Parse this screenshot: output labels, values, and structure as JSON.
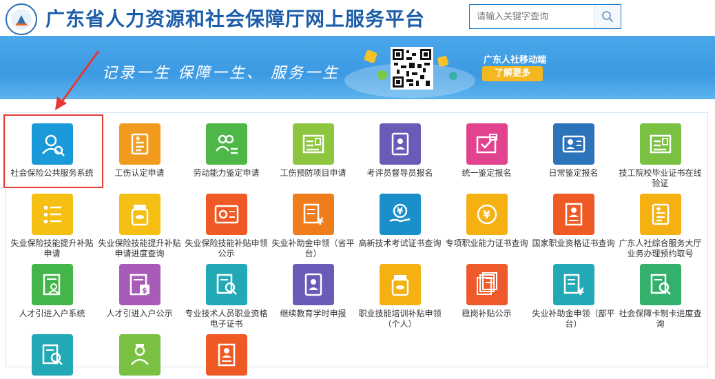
{
  "header": {
    "title": "广东省人力资源和社会保障厅网上服务平台",
    "search_placeholder": "请输入关键字查询"
  },
  "banner": {
    "slogan": "记录一生  保障一生、 服务一生",
    "mobile_label": "广东人社移动端",
    "more_button": "了解更多"
  },
  "services": [
    {
      "label": "社会保险公共服务系统",
      "icon": "user-search-icon",
      "color": "#1a9ad8"
    },
    {
      "label": "工伤认定申请",
      "icon": "document-plus-icon",
      "color": "#f29a1d"
    },
    {
      "label": "劳动能力鉴定申请",
      "icon": "people-transfer-icon",
      "color": "#4db848"
    },
    {
      "label": "工伤预防项目申请",
      "icon": "certificate-icon",
      "color": "#8cc63e"
    },
    {
      "label": "考评员督导员报名",
      "icon": "id-card-icon",
      "color": "#6b5ab8"
    },
    {
      "label": "统一鉴定报名",
      "icon": "approval-folder-icon",
      "color": "#e2438f"
    },
    {
      "label": "日常鉴定报名",
      "icon": "profile-edit-icon",
      "color": "#2d73b9"
    },
    {
      "label": "技工院校毕业证书在线验证",
      "icon": "certificate-icon",
      "color": "#7ac143"
    },
    {
      "label": "失业保险技能提升补贴申请",
      "icon": "checklist-icon",
      "color": "#f5c013"
    },
    {
      "label": "失业保险技能提升补贴申请进度查询",
      "icon": "pill-jar-icon",
      "color": "#f5c013"
    },
    {
      "label": "失业保险技能补贴申领公示",
      "icon": "money-card-icon",
      "color": "#ef5a24"
    },
    {
      "label": "失业补助金申领（省平台）",
      "icon": "document-yuan-icon",
      "color": "#ef7d1b"
    },
    {
      "label": "高新技术考试证书查询",
      "icon": "hand-yuan-icon",
      "color": "#1b8fc9"
    },
    {
      "label": "专项职业能力证书查询",
      "icon": "yuan-coin-icon",
      "color": "#f5b011"
    },
    {
      "label": "国家职业资格证书查询",
      "icon": "profile-card-icon",
      "color": "#ef5a24"
    },
    {
      "label": "广东人社综合服务大厅业务办理预约取号",
      "icon": "document-plus-icon",
      "color": "#f5b011"
    },
    {
      "label": "人才引进入户系统",
      "icon": "document-user-icon",
      "color": "#43b549"
    },
    {
      "label": "人才引进入户公示",
      "icon": "document-money-icon",
      "color": "#a85cb8"
    },
    {
      "label": "专业技术人员职业资格电子证书",
      "icon": "document-search-icon",
      "color": "#23a9b5"
    },
    {
      "label": "继续教育学时申报",
      "icon": "id-card-icon",
      "color": "#6b5ab8"
    },
    {
      "label": "职业技能培训补贴申领（个人）",
      "icon": "pill-jar-icon",
      "color": "#f5b011"
    },
    {
      "label": "稳岗补贴公示",
      "icon": "stacked-documents-icon",
      "color": "#ee5a2c"
    },
    {
      "label": "失业补助金申领（部平台）",
      "icon": "document-yuan-icon",
      "color": "#23a9b5"
    },
    {
      "label": "社会保障卡制卡进度查询",
      "icon": "document-search-icon",
      "color": "#33b06b"
    },
    {
      "label": "",
      "icon": "document-search-icon",
      "color": "#23a9b5"
    },
    {
      "label": "",
      "icon": "nurse-icon",
      "color": "#7ac143"
    },
    {
      "label": "",
      "icon": "profile-card-icon",
      "color": "#ef5a24"
    }
  ]
}
